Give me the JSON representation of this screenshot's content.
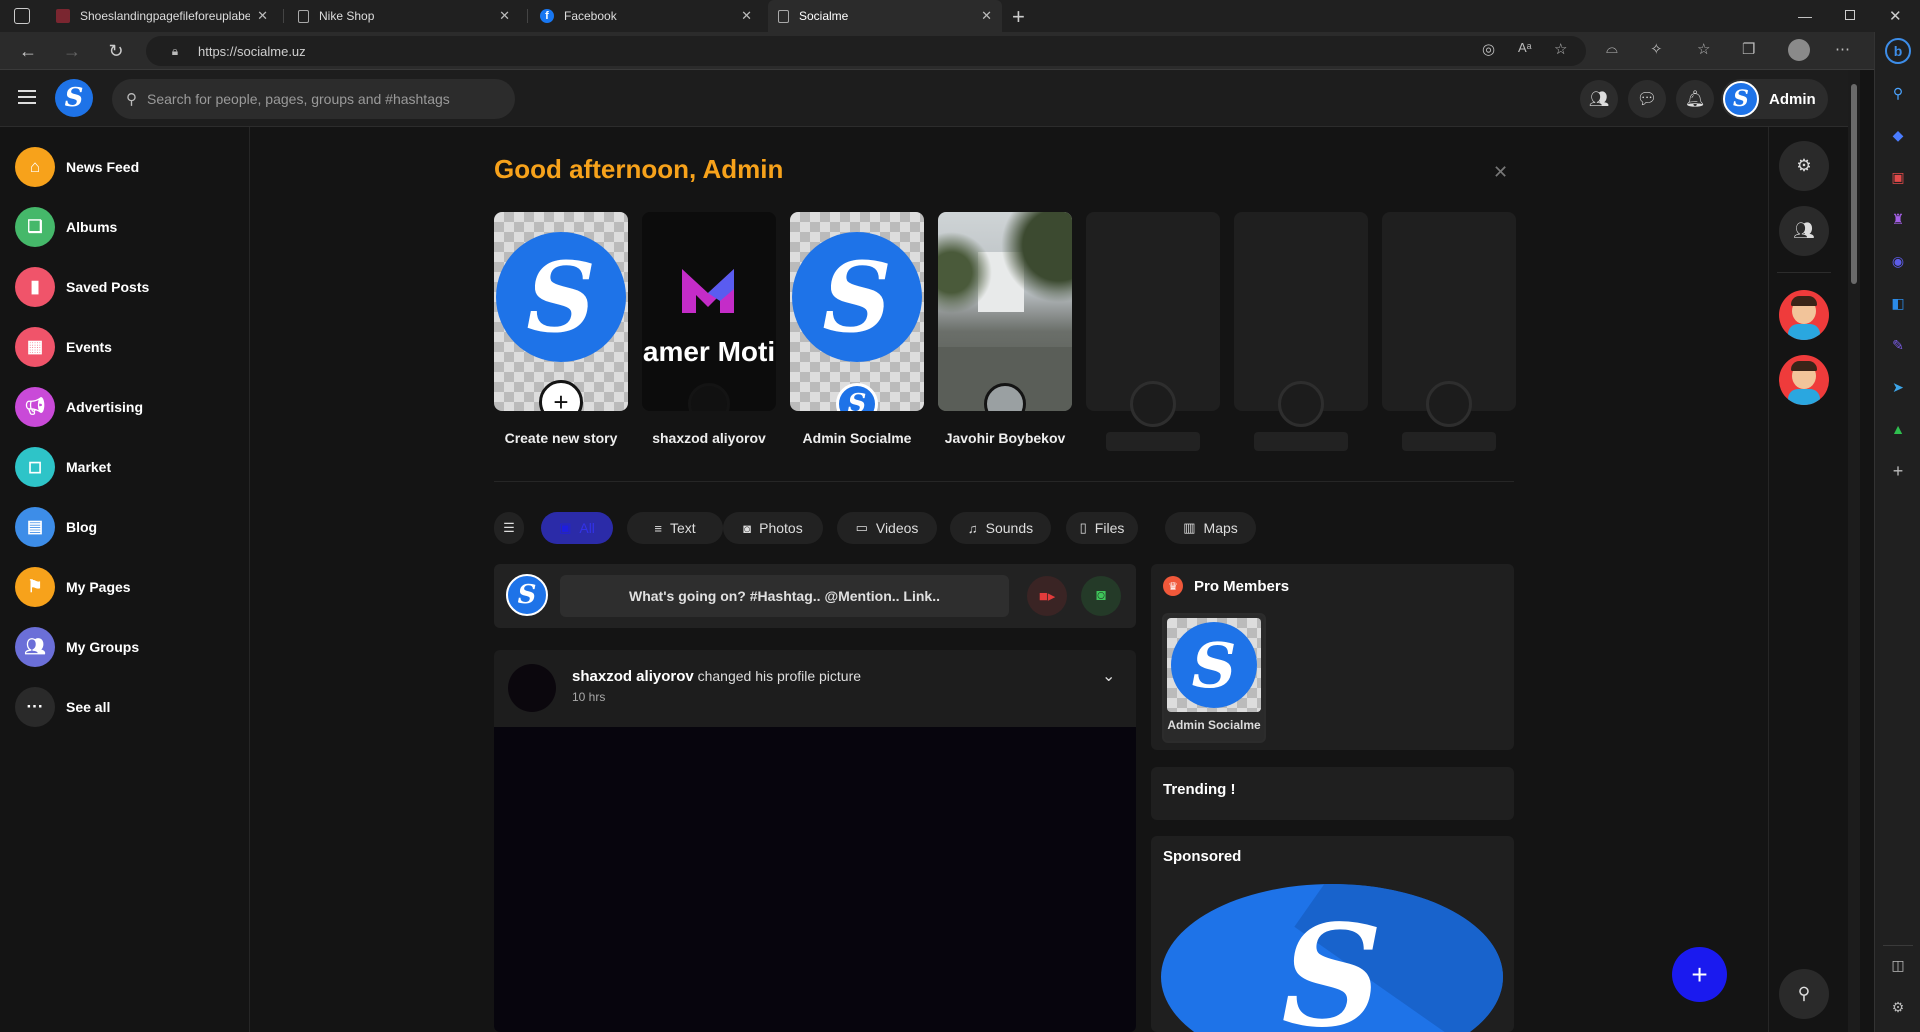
{
  "browser": {
    "tabs": [
      {
        "title": "Shoeslandingpagefileforeuplabe",
        "icon": "page-icon"
      },
      {
        "title": "Nike Shop",
        "icon": "page-icon"
      },
      {
        "title": "Facebook",
        "icon": "facebook-icon"
      },
      {
        "title": "Socialme",
        "icon": "page-icon"
      }
    ],
    "url": "https://socialme.uz"
  },
  "header": {
    "logo_letter": "S",
    "search_placeholder": "Search for people, pages, groups and #hashtags",
    "user_name": "Admin"
  },
  "leftnav": {
    "items": [
      {
        "label": "News Feed",
        "icon": "home-icon",
        "color": "#f7a21b"
      },
      {
        "label": "Albums",
        "icon": "albums-icon",
        "color": "#45b86a"
      },
      {
        "label": "Saved Posts",
        "icon": "bookmark-icon",
        "color": "#f0546a"
      },
      {
        "label": "Events",
        "icon": "calendar-icon",
        "color": "#f0546a"
      },
      {
        "label": "Advertising",
        "icon": "megaphone-icon",
        "color": "#c94ad8"
      },
      {
        "label": "Market",
        "icon": "shopping-bag-icon",
        "color": "#2ec4c8"
      },
      {
        "label": "Blog",
        "icon": "blog-icon",
        "color": "#3d8de8"
      },
      {
        "label": "My Pages",
        "icon": "flag-icon",
        "color": "#f7a21b"
      },
      {
        "label": "My Groups",
        "icon": "group-icon",
        "color": "#6b6fd8"
      },
      {
        "label": "See all",
        "icon": "more-icon",
        "color": "#2a2a2a"
      }
    ]
  },
  "main": {
    "greeting": "Good afternoon, Admin",
    "stories": [
      {
        "label": "Create new story"
      },
      {
        "label": "shaxzod aliyorov",
        "banner_text": "amer Moti"
      },
      {
        "label": "Admin Socialme"
      },
      {
        "label": "Javohir Boybekov"
      }
    ],
    "filters": [
      {
        "label": "All",
        "icon": "all-icon"
      },
      {
        "label": "Text",
        "icon": "text-icon"
      },
      {
        "label": "Photos",
        "icon": "camera-icon"
      },
      {
        "label": "Videos",
        "icon": "video-icon"
      },
      {
        "label": "Sounds",
        "icon": "music-icon"
      },
      {
        "label": "Files",
        "icon": "file-icon"
      },
      {
        "label": "Maps",
        "icon": "map-icon"
      }
    ],
    "composer_placeholder": "What's going on? #Hashtag.. @Mention.. Link..",
    "post": {
      "author": "shaxzod aliyorov",
      "action": "changed his profile picture",
      "time": "10 hrs"
    }
  },
  "sidebar": {
    "pro_members_title": "Pro Members",
    "pro_member_name": "Admin Socialme",
    "trending_title": "Trending !",
    "sponsored_title": "Sponsored"
  },
  "colors": {
    "accent": "#f7a21b",
    "brand": "#1e73e8",
    "fab": "#1a1aef"
  }
}
